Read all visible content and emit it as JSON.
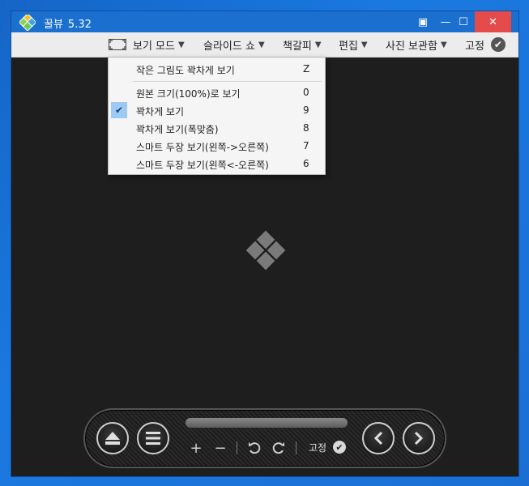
{
  "window": {
    "app_name": "꿀뷰",
    "version": "5.32",
    "close_label": "✕",
    "minimize_label": "—",
    "maximize_label": "☐",
    "pin_label": "▣"
  },
  "menubar": {
    "view_mode": "보기 모드",
    "slideshow": "슬라이드 쇼",
    "bookmark": "책갈피",
    "edit": "편집",
    "photo_box": "사진 보관함",
    "lock": "고정"
  },
  "view_mode_menu": {
    "items": [
      {
        "label": "작은 그림도 꽉차게 보기",
        "shortcut": "Z",
        "checked": false
      },
      {
        "label": "원본 크기(100%)로 보기",
        "shortcut": "0",
        "checked": false
      },
      {
        "label": "꽉차게 보기",
        "shortcut": "9",
        "checked": true
      },
      {
        "label": "꽉차게 보기(폭맞춤)",
        "shortcut": "8",
        "checked": false
      },
      {
        "label": "스마트 두장 보기(왼쪽->오른쪽)",
        "shortcut": "7",
        "checked": false
      },
      {
        "label": "스마트 두장 보기(왼쪽<-오른쪽)",
        "shortcut": "6",
        "checked": false
      }
    ]
  },
  "bottom_toolbar": {
    "zoom_in": "+",
    "zoom_out": "−",
    "lock_label": "고정"
  },
  "colors": {
    "titlebar": "#1a6fcf",
    "close_button": "#e64b4b",
    "viewer_background": "#1e1e1e",
    "menu_check_highlight": "#9ccaf4"
  }
}
